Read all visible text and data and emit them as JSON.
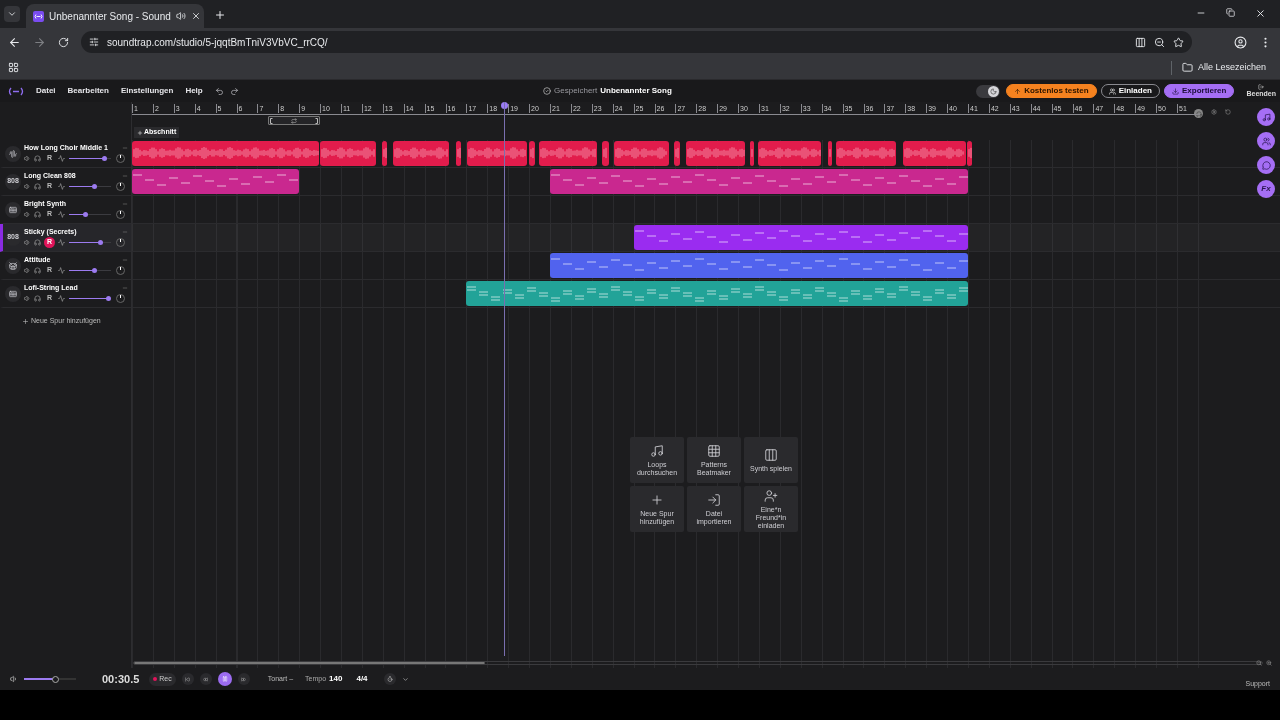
{
  "browser": {
    "tab_title": "Unbenannter Song - Sound",
    "url": "soundtrap.com/studio/5-jqqtBmTniV3VbVC_rrCQ/",
    "bookmarks_folder": "Alle Lesezeichen"
  },
  "menu": [
    "Datei",
    "Bearbeiten",
    "Einstellungen",
    "Help"
  ],
  "save_status": "Gespeichert",
  "song_title": "Unbenannter Song",
  "dark_mode": {
    "on": true
  },
  "actions": [
    {
      "label": "Kostenlos testen",
      "kind": "upgrade"
    },
    {
      "label": "Einladen",
      "kind": "invite"
    },
    {
      "label": "Exportieren",
      "kind": "export"
    }
  ],
  "exit_label": "Beenden",
  "ruler": {
    "bars": [
      "1",
      "2",
      "3",
      "4",
      "5",
      "6",
      "7",
      "8",
      "9",
      "10",
      "11",
      "12",
      "13",
      "14",
      "15",
      "16",
      "17",
      "18",
      "19",
      "20",
      "21",
      "22",
      "23",
      "24",
      "25",
      "26",
      "27",
      "28",
      "29",
      "30",
      "31",
      "32",
      "33",
      "34",
      "35",
      "36",
      "37",
      "38",
      "39",
      "40",
      "41",
      "42",
      "43",
      "44",
      "45",
      "46",
      "47",
      "48",
      "49",
      "50",
      "51"
    ]
  },
  "section_button": "Abschnitt",
  "tracks": [
    {
      "name": "How Long Choir Middle 1",
      "kind": "audio",
      "rec": "R",
      "selected": false,
      "armed": false,
      "level": 0.85,
      "color": "#e21c4c"
    },
    {
      "name": "Long Clean 808",
      "kind": "drum808",
      "badge": "808",
      "rec": "R",
      "selected": false,
      "armed": false,
      "level": 0.6,
      "color": "#c9288f"
    },
    {
      "name": "Bright Synth",
      "kind": "synth",
      "rec": "R",
      "selected": false,
      "armed": false,
      "level": 0.4
    },
    {
      "name": "Sticky (Secrets)",
      "kind": "drum808",
      "badge": "808",
      "rec": "R",
      "selected": true,
      "armed": true,
      "level": 0.75,
      "color": "#9a2cf0"
    },
    {
      "name": "Attitude",
      "kind": "drums",
      "rec": "R",
      "selected": false,
      "armed": false,
      "level": 0.6,
      "color": "#5163ee"
    },
    {
      "name": "Lofi-String Lead",
      "kind": "synth",
      "rec": "R",
      "selected": false,
      "armed": false,
      "level": 0.95,
      "color": "#22a398"
    }
  ],
  "add_track": "Neue Spur hinzufügen",
  "side_tools": [
    {
      "kind": "music"
    },
    {
      "kind": "people"
    },
    {
      "kind": "chat"
    },
    {
      "kind": "fx",
      "label": "Fx"
    }
  ],
  "quick_actions": [
    {
      "kind": "loops",
      "label": "Loops durchsuchen"
    },
    {
      "kind": "patterns",
      "label": "Patterns Beatmaker"
    },
    {
      "kind": "synth",
      "label": "Synth spielen"
    },
    {
      "kind": "add",
      "label": "Neue Spur hinzufügen"
    },
    {
      "kind": "import",
      "label": "Datei importieren"
    },
    {
      "kind": "invite",
      "label": "Eine*n Freund*in einladen"
    }
  ],
  "transport": {
    "volume": {
      "level": 0.6
    },
    "time": "00:30.5",
    "rec": "Rec",
    "playing": true,
    "key_label": "Tonart –",
    "tempo_label": "Tempo",
    "tempo": "140",
    "meter": "4/4"
  },
  "support": "Support"
}
